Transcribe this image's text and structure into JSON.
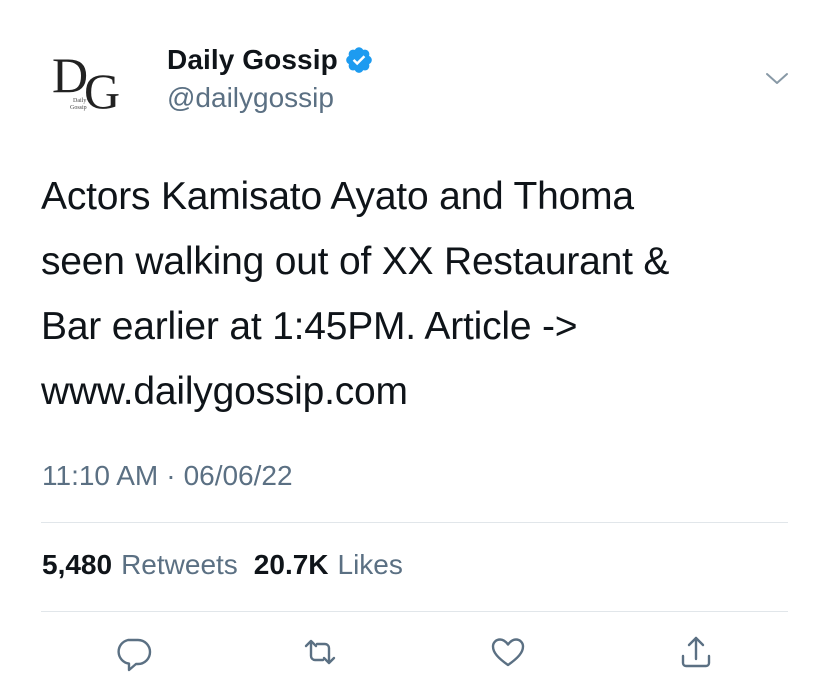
{
  "account": {
    "display_name": "Daily Gossip",
    "handle": "@dailygossip",
    "avatar_monogram": "DG",
    "avatar_subtext": "Daily Gossip",
    "verified": true
  },
  "tweet": {
    "text": "Actors Kamisato Ayato and Thoma\nseen walking out of XX Restaurant &\nBar earlier at 1:45PM. Article ->\nwww.dailygossip.com",
    "time": "11:10 AM",
    "separator": "·",
    "date": "06/06/22"
  },
  "stats": {
    "retweets_count": "5,480",
    "retweets_label": "Retweets",
    "likes_count": "20.7K",
    "likes_label": "Likes"
  },
  "icons": {
    "more": "chevron-down-icon",
    "reply": "reply-icon",
    "retweet": "retweet-icon",
    "like": "heart-icon",
    "share": "share-icon",
    "verified": "verified-badge-icon"
  },
  "colors": {
    "text_primary": "#0f1419",
    "text_secondary": "#5b7083",
    "verified_blue": "#1d9bf0",
    "divider": "#e1e6ea"
  }
}
